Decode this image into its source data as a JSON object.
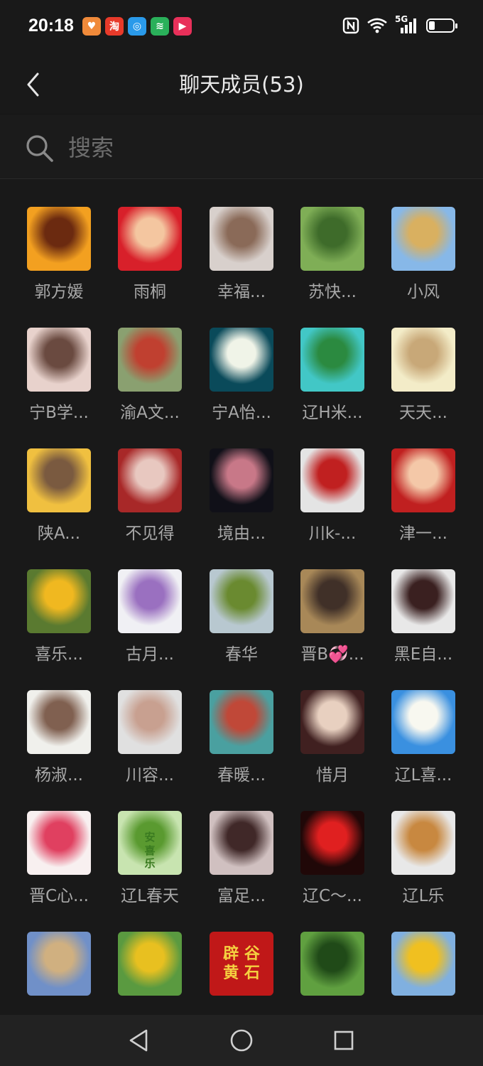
{
  "status_bar": {
    "time": "20:18",
    "network_label": "5G"
  },
  "header": {
    "title": "聊天成员(53)"
  },
  "search": {
    "placeholder": "搜索"
  },
  "members": [
    {
      "name": "郭方媛",
      "colors": [
        "#f3a020",
        "#6b2a10"
      ]
    },
    {
      "name": "雨桐",
      "colors": [
        "#d8202a",
        "#f4c6a0"
      ]
    },
    {
      "name": "幸福...",
      "colors": [
        "#d8d0cc",
        "#8a6a58"
      ]
    },
    {
      "name": "苏快...",
      "colors": [
        "#7fae56",
        "#3e6b2a"
      ]
    },
    {
      "name": "小风",
      "colors": [
        "#87b8e8",
        "#d9b060"
      ]
    },
    {
      "name": "宁B学...",
      "colors": [
        "#e8d2cc",
        "#6a4a40"
      ]
    },
    {
      "name": "渝A文...",
      "colors": [
        "#8aa070",
        "#c04030"
      ]
    },
    {
      "name": "宁A怡...",
      "colors": [
        "#0a4a5a",
        "#f0f4e8"
      ]
    },
    {
      "name": "辽H米...",
      "colors": [
        "#42c7c6",
        "#2b8a40"
      ]
    },
    {
      "name": "天天...",
      "colors": [
        "#f3ecc8",
        "#c8a878"
      ]
    },
    {
      "name": "陕A...",
      "colors": [
        "#f0c040",
        "#7a5a40"
      ]
    },
    {
      "name": "不见得",
      "colors": [
        "#a82828",
        "#e8c8c0"
      ]
    },
    {
      "name": "境由...",
      "colors": [
        "#101018",
        "#c87888"
      ]
    },
    {
      "name": "川k-...",
      "colors": [
        "#e4e4e4",
        "#c02020"
      ]
    },
    {
      "name": "津一...",
      "colors": [
        "#c02020",
        "#f4c8a8"
      ]
    },
    {
      "name": "喜乐...",
      "colors": [
        "#5a7a30",
        "#f0b820"
      ]
    },
    {
      "name": "古月...",
      "colors": [
        "#f0f0f4",
        "#9a70c0"
      ]
    },
    {
      "name": "春华",
      "colors": [
        "#b8c8d0",
        "#6a8a30"
      ]
    },
    {
      "name": "晋B💞...",
      "colors": [
        "#a88858",
        "#403028"
      ]
    },
    {
      "name": "黑E自...",
      "colors": [
        "#e8e8e8",
        "#3a2020"
      ]
    },
    {
      "name": "杨淑...",
      "colors": [
        "#f0f0ec",
        "#806050"
      ]
    },
    {
      "name": "川容...",
      "colors": [
        "#e0e0e0",
        "#c8a090"
      ]
    },
    {
      "name": "春暖...",
      "colors": [
        "#4aa0a0",
        "#c04838"
      ]
    },
    {
      "name": "惜月",
      "colors": [
        "#402020",
        "#e8d0c0"
      ]
    },
    {
      "name": "辽L喜...",
      "colors": [
        "#3a90e0",
        "#f8f8f0"
      ]
    },
    {
      "name": "晋C心...",
      "colors": [
        "#f8f0f0",
        "#e04060"
      ]
    },
    {
      "name": "辽L春天",
      "colors": [
        "#c8e4b0",
        "#5a9a30"
      ],
      "label": "安\n喜\n乐"
    },
    {
      "name": "富足...",
      "colors": [
        "#d0c0c0",
        "#402828"
      ]
    },
    {
      "name": "辽C～...",
      "colors": [
        "#200808",
        "#e02020"
      ]
    },
    {
      "name": "辽L乐",
      "colors": [
        "#e8e8e8",
        "#c88840"
      ]
    },
    {
      "name": "",
      "colors": [
        "#7090c8",
        "#d0b080"
      ]
    },
    {
      "name": "",
      "colors": [
        "#5a9a40",
        "#e8c020"
      ]
    },
    {
      "name": "",
      "colors": [
        "#c01818",
        "#c01818"
      ],
      "label": "辟 谷\n黄 石"
    },
    {
      "name": "",
      "colors": [
        "#60a040",
        "#204a18"
      ]
    },
    {
      "name": "",
      "colors": [
        "#80b0e0",
        "#f0c020"
      ]
    }
  ]
}
